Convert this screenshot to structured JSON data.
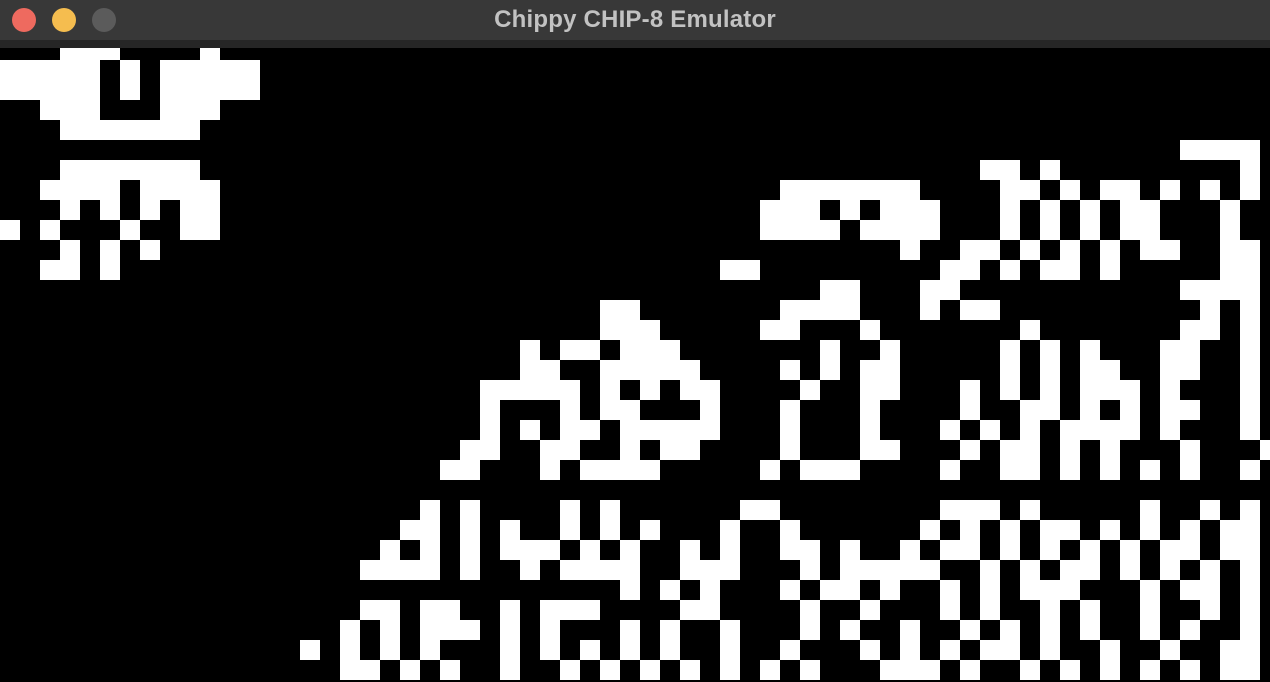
{
  "window": {
    "title": "Chippy CHIP-8 Emulator"
  },
  "controls": {
    "close": {
      "icon": "close-icon",
      "color": "#ee6a5f"
    },
    "minimize": {
      "icon": "minimize-icon",
      "color": "#f5bd4f"
    },
    "zoom": {
      "icon": "zoom-icon",
      "color": "#5b5b5b"
    }
  },
  "display": {
    "foreground": "#ffffff",
    "background": "#000000",
    "framebuffer": [
      "...###....#....................................................",
      "#####.#.#####..................................................",
      "#####.#.#####..................................................",
      "..###...###....................................................",
      "...#######.....................................................",
      "...........................................................####",
      "...#######.......................................##.#.........#",
      "..####.####............................#######....##.#.##.#.#.#",
      "...#.#.#.##...........................###.#.###...#.#.#.##...#",
      "#.#...#..##...........................####.####...#.#.#.##...#",
      "...#.#.#.....................................#..##.#.#.#.##..##",
      "..##.#..............................##.........##.#.##.#.....##",
      ".........................................##...##...........####",
      "..............................##.......####...#.##..........#.#",
      "..............................###.....##...#.......#.......##.#",
      "..........................#.##.###.......#..#.....#.#.#...##..#",
      "..........................##..#####....#.#.##.....#.#.##..##..#",
      "........................#####.#.#.##....#..##...#.#.#.###.#...#",
      "........................#...#.##...#...#...#....#..##.#.#.##..#",
      "........................#.#.##.#####...#...#...#.#.#.####.#...#",
      ".......................##..##..#.##....#...##...#.##.#.#...#...#",
      "......................##...#.####.....#.###....#..##.#.#.#.#..#",
      "................................................................",
      ".....................#.#....#.#......##........###.#.....#..#.#",
      "....................##.#.#..#.#.#...#..#......#.#.#.##.#.#.#.##",
      "...................#.#.#.###.#.#..#.#..##.#..#.##.#.#.#.#.##.##",
      "..................####.#..#.####..###...#.#####..#.#.##.#.#.#.#",
      "...............................#.#.#...#.##.#..#.#.###...#.##.#",
      "..................##.##..#.###....##....#..#...#.#..#.#..#..#.#",
      ".................#.#.###.#.#...#.#..#...#.#..#..#.#.#.#..#.#..#",
      "...............#.#.#.#...#.#.#.#.#..#..#...#.#.#.##.#..#..#..##",
      ".................##.#.#..#..#.#.#.#.#.#.#...###.#..#.#.#.#.#.##"
    ]
  }
}
